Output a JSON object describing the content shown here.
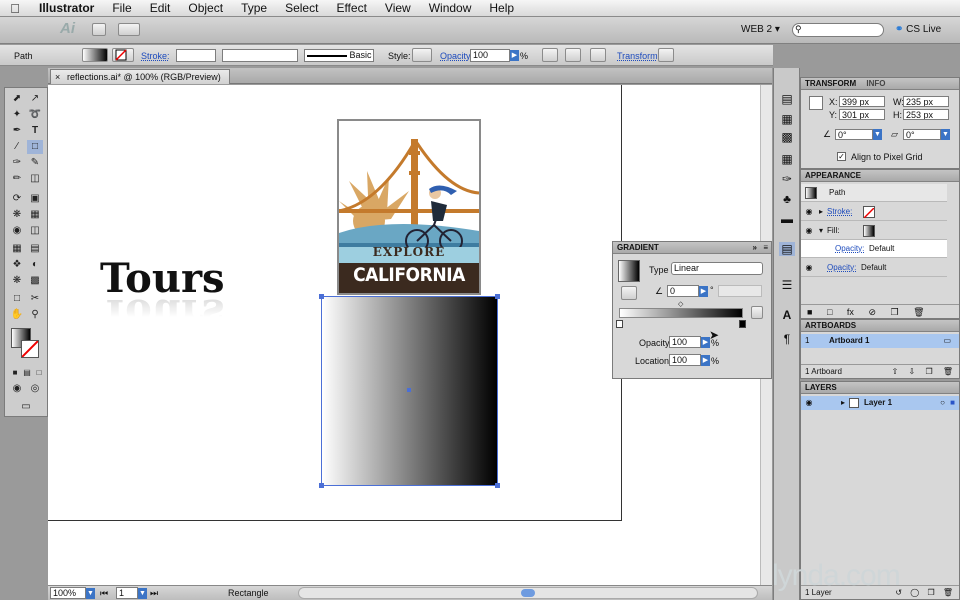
{
  "menubar": {
    "app": "Illustrator",
    "items": [
      "File",
      "Edit",
      "Object",
      "Type",
      "Select",
      "Effect",
      "View",
      "Window",
      "Help"
    ]
  },
  "appbar": {
    "logo": "Ai",
    "workspace": "WEB 2 ▾",
    "search_placeholder": "",
    "cslive": "CS Live"
  },
  "control": {
    "object_type": "Path",
    "stroke_label": "Stroke:",
    "stroke_profile": "Basic",
    "style_label": "Style:",
    "opacity_label": "Opacity:",
    "opacity_value": "100",
    "opacity_unit": "%",
    "transform_link": "Transform"
  },
  "document": {
    "tab_title": "reflections.ai* @ 100% (RGB/Preview)",
    "tours_text": "Tours",
    "poster_top": "EXPLORE",
    "poster_bottom": "CALIFORNIA"
  },
  "status": {
    "zoom": "100%",
    "artboard_num": "1",
    "tool_name": "Rectangle"
  },
  "gradient_panel": {
    "title": "GRADIENT",
    "type_label": "Type",
    "type_value": "Linear",
    "angle_value": "0",
    "angle_unit": "°",
    "opacity_label": "Opacity:",
    "opacity_value": "100",
    "location_label": "Location:",
    "location_value": "100",
    "pct": "%"
  },
  "transform_panel": {
    "tab1": "TRANSFORM",
    "tab2": "INFO",
    "x_label": "X:",
    "x_value": "399 px",
    "y_label": "Y:",
    "y_value": "301 px",
    "w_label": "W:",
    "w_value": "235 px",
    "h_label": "H:",
    "h_value": "253 px",
    "rot_value": "0°",
    "shear_value": "0°",
    "align_label": "Align to Pixel Grid"
  },
  "appearance_panel": {
    "title": "APPEARANCE",
    "path_label": "Path",
    "stroke_label": "Stroke:",
    "fill_label": "Fill:",
    "opacity_label": "Opacity:",
    "opacity_value": "Default",
    "opacity2_label": "Opacity:",
    "opacity2_value": "Default"
  },
  "artboards_panel": {
    "title": "ARTBOARDS",
    "row_num": "1",
    "row_name": "Artboard 1",
    "footer": "1 Artboard"
  },
  "layers_panel": {
    "title": "LAYERS",
    "layer_name": "Layer 1",
    "footer": "1 Layer"
  },
  "watermark": "lynda.com",
  "colors": {
    "selection_blue": "#4b6fd6",
    "panel_grey": "#d8d8d8",
    "poster_brown": "#3b2a1f",
    "bridge_orange": "#c47a2c",
    "sky_blue": "#9dcfe0"
  }
}
